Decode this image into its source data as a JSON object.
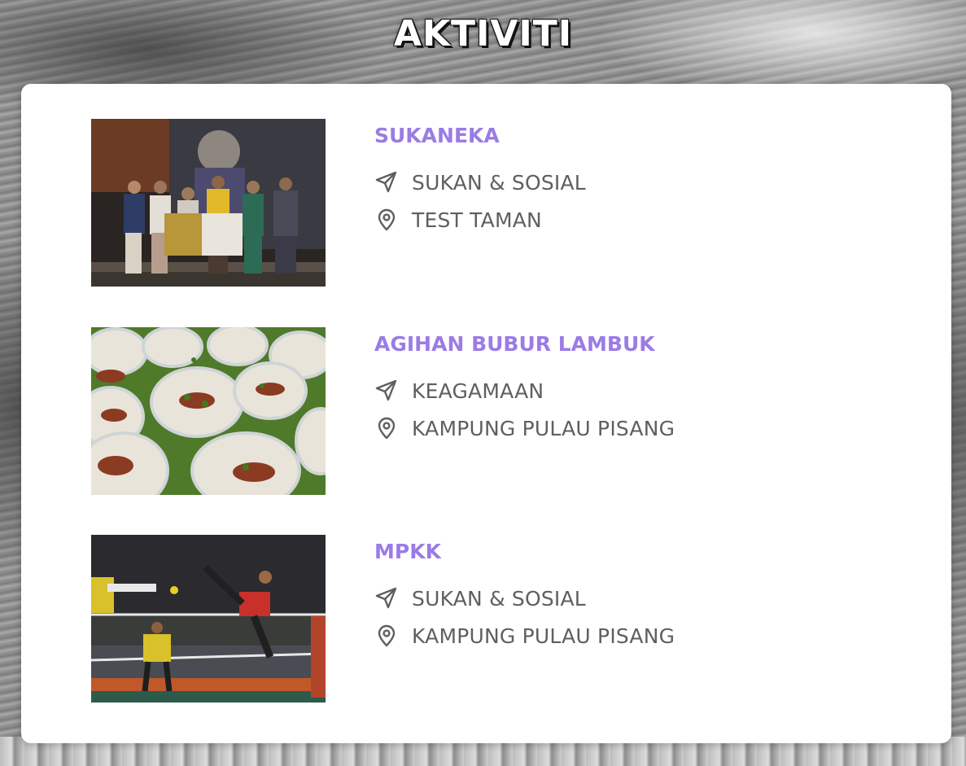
{
  "page": {
    "title": "AKTIVITI"
  },
  "activities": [
    {
      "title": "SUKANEKA",
      "category": "SUKAN & SOSIAL",
      "location": "TEST TAMAN",
      "image": "award-ceremony-photo"
    },
    {
      "title": "AGIHAN BUBUR LAMBUK",
      "category": "KEAGAMAAN",
      "location": "KAMPUNG PULAU PISANG",
      "image": "bubur-lambuk-photo"
    },
    {
      "title": "MPKK",
      "category": "SUKAN & SOSIAL",
      "location": "KAMPUNG PULAU PISANG",
      "image": "sepak-takraw-photo"
    }
  ],
  "icons": {
    "category": "paper-plane-icon",
    "location": "map-pin-icon"
  },
  "colors": {
    "accent": "#9b7be6",
    "meta_text": "#5f5f5f",
    "card": "#ffffff"
  }
}
